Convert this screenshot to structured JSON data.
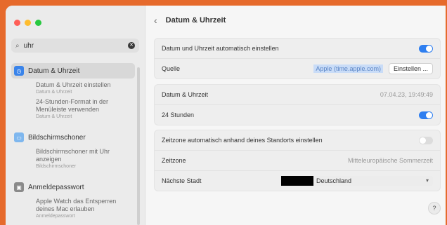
{
  "sidebar": {
    "search": {
      "value": "uhr",
      "placeholder": ""
    },
    "groups": [
      {
        "label": "Datum & Uhrzeit",
        "icon": "clock-icon",
        "items": [
          {
            "title": "Datum & Uhrzeit einstellen",
            "caption": "Datum & Uhrzeit"
          },
          {
            "title": "24-Stunden-Format in der Menüleiste verwenden",
            "caption": "Datum & Uhrzeit"
          }
        ]
      },
      {
        "label": "Bildschirmschoner",
        "icon": "screensaver-icon",
        "items": [
          {
            "title": "Bildschirmschoner mit Uhr anzeigen",
            "caption": "Bildschirmschoner"
          }
        ]
      },
      {
        "label": "Anmeldepasswort",
        "icon": "lock-icon",
        "items": [
          {
            "title": "Apple Watch das Entsperren deines Mac erlauben",
            "caption": "Anmeldepasswort"
          }
        ]
      }
    ]
  },
  "main": {
    "title": "Datum & Uhrzeit",
    "rows": {
      "auto_label": "Datum und Uhrzeit automatisch einstellen",
      "auto_on": true,
      "source_label": "Quelle",
      "source_value": "Apple (time.apple.com)",
      "source_button": "Einstellen ...",
      "datetime_label": "Datum & Uhrzeit",
      "datetime_value": "07.04.23, 19:49:49",
      "h24_label": "24 Stunden",
      "h24_on": true,
      "tz_auto_label": "Zeitzone automatisch anhand deines Standorts einstellen",
      "tz_auto_on": false,
      "tz_label": "Zeitzone",
      "tz_value": "Mitteleuropäische Sommerzeit",
      "city_label": "Nächste Stadt",
      "city_value": "Deutschland"
    },
    "help": "?"
  },
  "colors": {
    "accent": "#2f7ff0",
    "background": "#e66a2c"
  }
}
